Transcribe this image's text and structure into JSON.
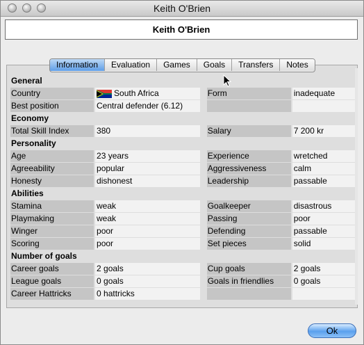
{
  "window": {
    "title": "Keith O'Brien"
  },
  "player_name": "Keith O'Brien",
  "tabs": [
    "Information",
    "Evaluation",
    "Games",
    "Goals",
    "Transfers",
    "Notes"
  ],
  "active_tab": "Information",
  "sections": {
    "general": "General",
    "economy": "Economy",
    "personality": "Personality",
    "abilities": "Abilities",
    "goals": "Number of goals"
  },
  "general": {
    "country_label": "Country",
    "country_value": "South Africa",
    "form_label": "Form",
    "form_value": "inadequate",
    "position_label": "Best position",
    "position_value": "Central defender (6.12)"
  },
  "economy": {
    "tsi_label": "Total Skill Index",
    "tsi_value": "380",
    "salary_label": "Salary",
    "salary_value": "7 200 kr"
  },
  "personality": {
    "age_label": "Age",
    "age_value": "23 years",
    "experience_label": "Experience",
    "experience_value": "wretched",
    "agree_label": "Agreeability",
    "agree_value": "popular",
    "aggr_label": "Aggressiveness",
    "aggr_value": "calm",
    "honesty_label": "Honesty",
    "honesty_value": "dishonest",
    "leader_label": "Leadership",
    "leader_value": "passable"
  },
  "abilities": {
    "stamina_label": "Stamina",
    "stamina_value": "weak",
    "gk_label": "Goalkeeper",
    "gk_value": "disastrous",
    "play_label": "Playmaking",
    "play_value": "weak",
    "pass_label": "Passing",
    "pass_value": "poor",
    "wing_label": "Winger",
    "wing_value": "poor",
    "def_label": "Defending",
    "def_value": "passable",
    "score_label": "Scoring",
    "score_value": "poor",
    "sp_label": "Set pieces",
    "sp_value": "solid"
  },
  "goals": {
    "career_label": "Career goals",
    "career_value": "2 goals",
    "cup_label": "Cup goals",
    "cup_value": "2 goals",
    "league_label": "League goals",
    "league_value": "0 goals",
    "friendly_label": "Goals in friendlies",
    "friendly_value": "0 goals",
    "hat_label": "Career Hattricks",
    "hat_value": "0 hattricks"
  },
  "ok_label": "Ok"
}
